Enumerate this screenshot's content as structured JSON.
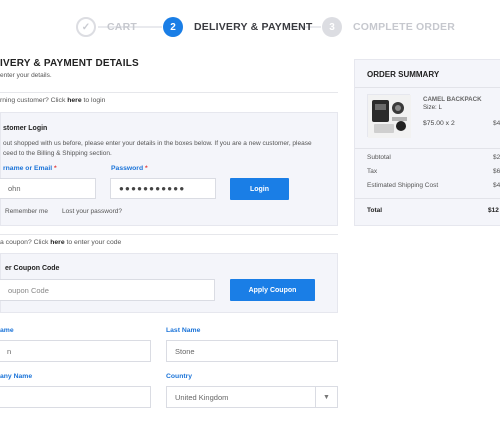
{
  "steps": [
    {
      "num": "✓",
      "label": "CART",
      "state": "done"
    },
    {
      "num": "2",
      "label": "DELIVERY & PAYMENT",
      "state": "active"
    },
    {
      "num": "3",
      "label": "COMPLETE ORDER",
      "state": "todo"
    }
  ],
  "main": {
    "title": "IVERY & PAYMENT DETAILS",
    "subtitle": "enter your details.",
    "returning_prefix": "rning customer? Click ",
    "returning_link": "here",
    "returning_suffix": " to login",
    "coupon_prefix": "a coupon? Click ",
    "coupon_link": "here",
    "coupon_suffix": " to enter your code"
  },
  "login": {
    "title": "stomer Login",
    "description": "out shopped with us before, please enter your details in the boxes below. If you are a new customer, please ceed to the Billing & Shipping section.",
    "username_label": "rname or Email",
    "username_value": "ohn",
    "password_label": "Password",
    "password_value": "●●●●●●●●●●●",
    "login_button": "Login",
    "remember_me": "Remember me",
    "lost_password": "Lost your password?"
  },
  "coupon": {
    "title": "er Coupon Code",
    "placeholder": "oupon Code",
    "apply_button": "Apply Coupon"
  },
  "billing": {
    "first_name_label": "ame",
    "first_name_value": "n",
    "last_name_label": "Last Name",
    "last_name_value": "Stone",
    "company_label": "any Name",
    "country_label": "Country",
    "country_value": "United Kingdom"
  },
  "summary": {
    "title": "ORDER SUMMARY",
    "product_name": "CAMEL BACKPACK",
    "product_size": "Size: L",
    "product_price": "$75.00 x 2",
    "product_total": "$4",
    "rows": [
      {
        "label": "Subtotal",
        "value": "$2"
      },
      {
        "label": "Tax",
        "value": "$6"
      },
      {
        "label": "Estimated Shipping Cost",
        "value": "$4"
      }
    ],
    "total_label": "Total",
    "total_value": "$12"
  },
  "colors": {
    "accent": "#1a7ee6",
    "label_blue": "#1a73d8",
    "panel_bg": "#f4f5fa",
    "required": "#e03a3a"
  }
}
